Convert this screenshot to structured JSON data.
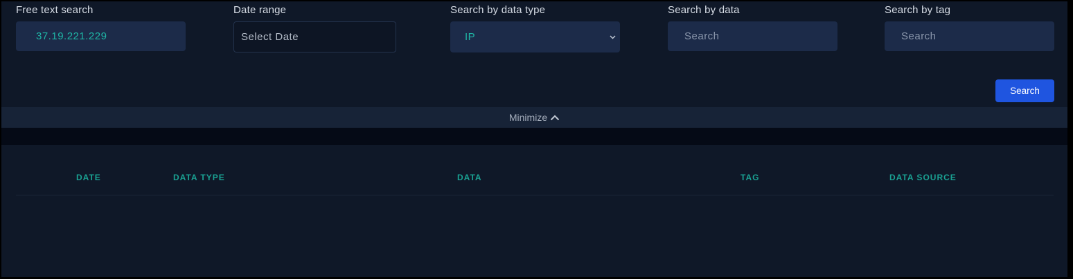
{
  "filters": {
    "free_text": {
      "label": "Free text search",
      "value": "37.19.221.229"
    },
    "date_range": {
      "label": "Date range",
      "placeholder": "Select Date"
    },
    "data_type": {
      "label": "Search by data type",
      "selected": "IP"
    },
    "data": {
      "label": "Search by data",
      "placeholder": "Search"
    },
    "tag": {
      "label": "Search by tag",
      "placeholder": "Search"
    },
    "search_button": "Search"
  },
  "minimize": {
    "label": "Minimize",
    "icon": "chevron-up-icon"
  },
  "table": {
    "columns": [
      "DATE",
      "DATA TYPE",
      "DATA",
      "TAG",
      "DATA SOURCE"
    ],
    "rows": []
  },
  "colors": {
    "accent_teal": "#1fb5a5",
    "primary_button": "#1f55e0",
    "panel_bg": "#0f1828",
    "input_bg": "#1c2b49"
  }
}
